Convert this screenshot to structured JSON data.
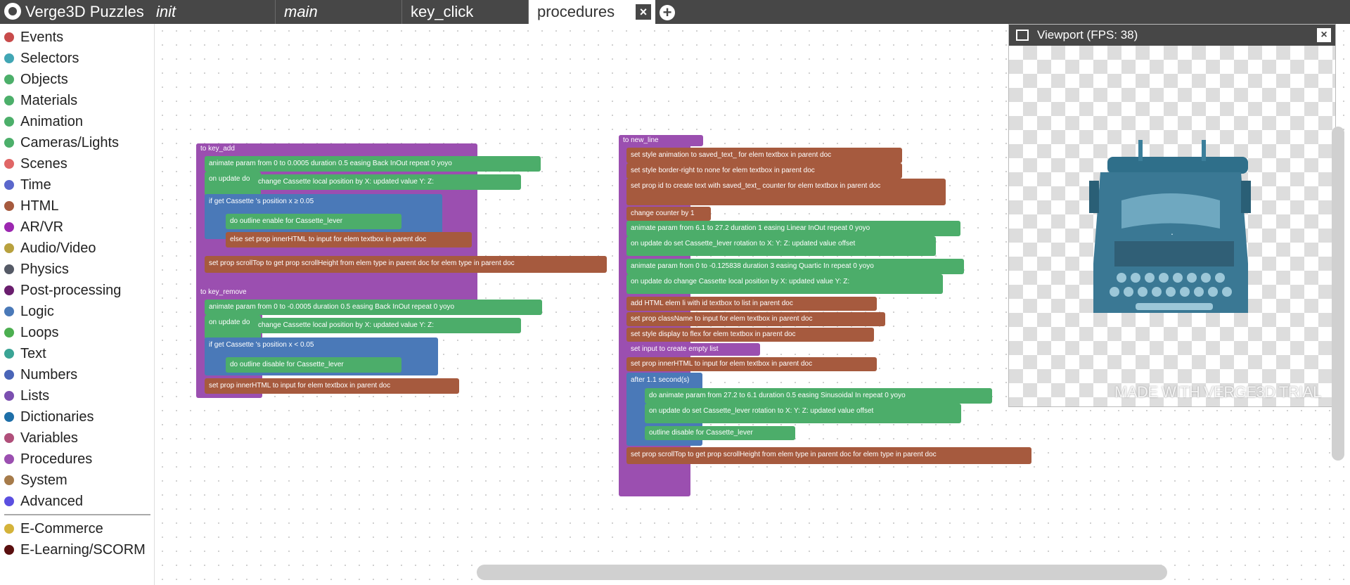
{
  "app": {
    "title": "Verge3D Puzzles"
  },
  "tabs": [
    {
      "label": "init"
    },
    {
      "label": "main"
    },
    {
      "label": "key_click"
    },
    {
      "label": "procedures"
    }
  ],
  "categories": [
    {
      "label": "Events",
      "color": "#c84b4b"
    },
    {
      "label": "Selectors",
      "color": "#41a6b4"
    },
    {
      "label": "Objects",
      "color": "#4caf6a"
    },
    {
      "label": "Materials",
      "color": "#4caf6a"
    },
    {
      "label": "Animation",
      "color": "#4caf6a"
    },
    {
      "label": "Cameras/Lights",
      "color": "#4caf6a"
    },
    {
      "label": "Scenes",
      "color": "#e06666"
    },
    {
      "label": "Time",
      "color": "#5b67cc"
    },
    {
      "label": "HTML",
      "color": "#a65a3e"
    },
    {
      "label": "AR/VR",
      "color": "#9c27b0"
    },
    {
      "label": "Audio/Video",
      "color": "#b8a13e"
    },
    {
      "label": "Physics",
      "color": "#4caf6a"
    },
    {
      "label": "Post-processing",
      "color": "#6a1e6e"
    },
    {
      "label": "Logic",
      "color": "#4a79b8"
    },
    {
      "label": "Loops",
      "color": "#4caf50"
    },
    {
      "label": "Text",
      "color": "#3aa495"
    },
    {
      "label": "Numbers",
      "color": "#4a65b8"
    },
    {
      "label": "Lists",
      "color": "#7b4fb0"
    },
    {
      "label": "Dictionaries",
      "color": "#1e6fa8"
    },
    {
      "label": "Variables",
      "color": "#b04f7a"
    },
    {
      "label": "Procedures",
      "color": "#9b4fb0"
    },
    {
      "label": "System",
      "color": "#a67b4a"
    },
    {
      "label": "Advanced",
      "color": "#5b4fe0"
    },
    {
      "label": "E-Commerce",
      "color": "#d4b33a"
    },
    {
      "label": "E-Learning/SCORM",
      "color": "#5a0f0f"
    }
  ],
  "viewport": {
    "title": "Viewport (FPS: 38)",
    "watermark": "MADE WITH VERGE3D TRIAL"
  },
  "blocks": {
    "key_add": {
      "header": "to key_add",
      "anim": "animate param from 0 to 0.0005 duration 0.5 easing Back InOut repeat 0 yoyo",
      "update": "on update do",
      "change": "change Cassette local position by X: updated value Y: Z:",
      "if": "if get Cassette 's position x ≥ 0.05",
      "do": "do outline enable for Cassette_lever",
      "else": "else set prop innerHTML to input for elem textbox in parent doc",
      "scroll": "set prop scrollTop to get prop scrollHeight from elem type in parent doc for elem type in parent doc"
    },
    "key_remove": {
      "header": "to key_remove",
      "anim": "animate param from 0 to -0.0005 duration 0.5 easing Back InOut repeat 0 yoyo",
      "update": "on update do",
      "change": "change Cassette local position by X: updated value Y: Z:",
      "if": "if get Cassette 's position x < 0.05",
      "do": "do outline disable for Cassette_lever",
      "set": "set prop innerHTML to input for elem textbox in parent doc"
    },
    "new_line": {
      "header": "to new_line",
      "r1": "set style animation to saved_text_ for elem textbox in parent doc",
      "r2": "set style border-right to none for elem textbox in parent doc",
      "r3": "set prop id to create text with saved_text_ counter for elem textbox in parent doc",
      "r4": "change counter by 1",
      "r5": "animate param from 6.1 to 27.2 duration 1 easing Linear InOut repeat 0 yoyo",
      "r6": "on update do set Cassette_lever rotation to X: Y: Z: updated value offset",
      "r7": "animate param from 0 to -0.125838 duration 3 easing Quartic In repeat 0 yoyo",
      "r8": "on update do change Cassette local position by X: updated value Y: Z:",
      "r9": "add HTML elem li with id textbox to list in parent doc",
      "r10": "set prop className to input for elem textbox in parent doc",
      "r11": "set style display to flex for elem textbox in parent doc",
      "r12": "set input to create empty list",
      "r13": "set prop innerHTML to input for elem textbox in parent doc",
      "r14": "after 1.1 second(s)",
      "r15": "do animate param from 27.2 to 6.1 duration 0.5 easing Sinusoidal In repeat 0 yoyo",
      "r16": "on update do set Cassette_lever rotation to X: Y: Z: updated value offset",
      "r17": "outline disable for Cassette_lever",
      "r18": "set prop scrollTop to get prop scrollHeight from elem type in parent doc for elem type in parent doc"
    }
  }
}
